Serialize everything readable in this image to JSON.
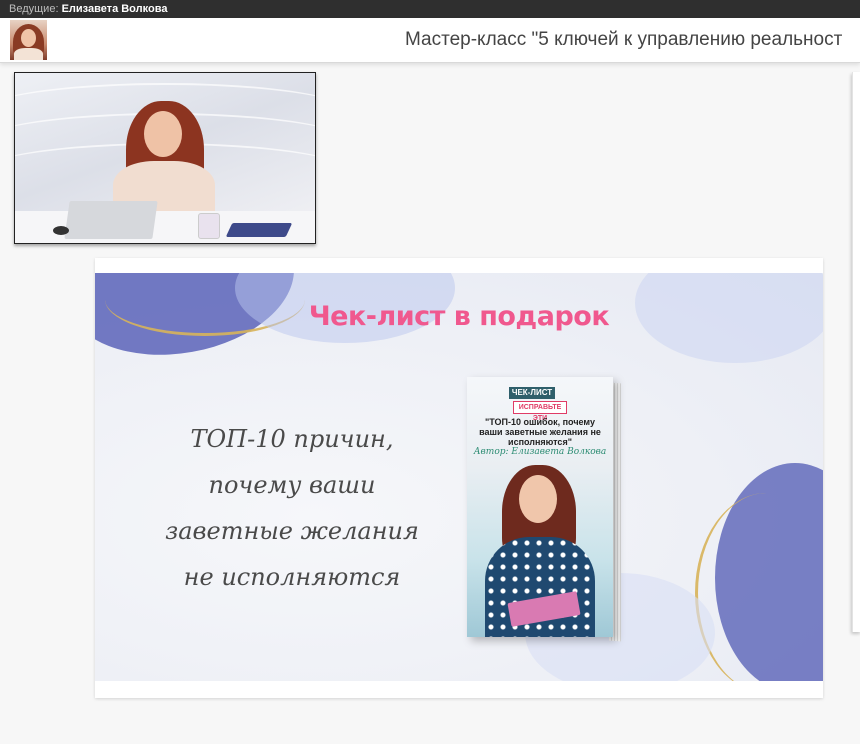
{
  "topbar": {
    "host_prefix": "Ведущие:",
    "host_name": "Елизавета Волкова"
  },
  "header": {
    "session_title": "Мастер-класс \"5 ключей к управлению реальност"
  },
  "slide": {
    "title": "Чек-лист в подарок",
    "text_lines": [
      "ТОП-10 причин,",
      "почему ваши",
      "заветные желания",
      "не исполняются"
    ],
    "book": {
      "tag": "ЧЕК-ЛИСТ",
      "stamp": "ИСПРАВЬТЕ ЭТИ",
      "subtitle": "\"ТОП-10 ошибок, почему ваши заветные желания не исполняются\"",
      "author": "Автор: Елизавета Волкова"
    }
  },
  "colors": {
    "accent_pink": "#f0588e",
    "topbar_bg": "#2f2f2f"
  }
}
